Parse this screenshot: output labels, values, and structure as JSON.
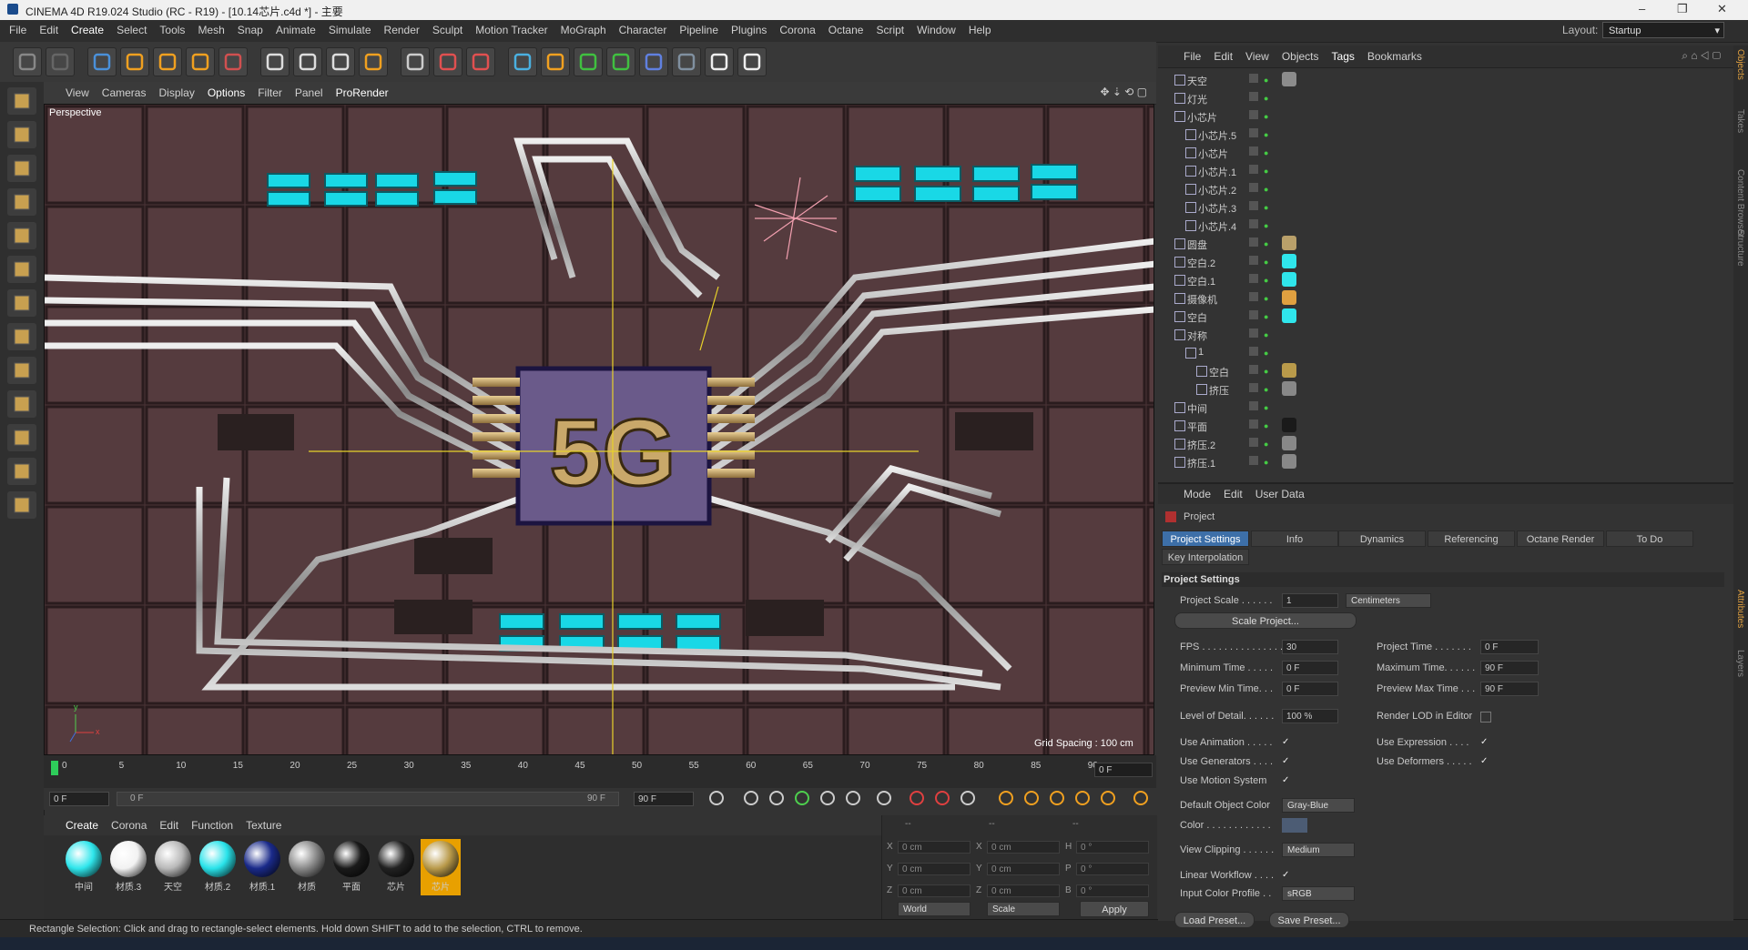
{
  "window": {
    "title": "CINEMA 4D R19.024 Studio (RC - R19) - [10.14芯片.c4d *] - 主要",
    "layout_label": "Layout:",
    "layout_value": "Startup",
    "minimize": "–",
    "maximize": "❐",
    "close": "✕"
  },
  "menubar": [
    "File",
    "Edit",
    "Create",
    "Select",
    "Tools",
    "Mesh",
    "Snap",
    "Animate",
    "Simulate",
    "Render",
    "Sculpt",
    "Motion Tracker",
    "MoGraph",
    "Character",
    "Pipeline",
    "Plugins",
    "Corona",
    "Octane",
    "Script",
    "Window",
    "Help"
  ],
  "toolbar_icons": [
    "undo-icon",
    "redo-icon",
    "live-selection-icon",
    "move-icon",
    "scale-icon",
    "rotate-icon",
    "recent-tools-icon",
    "x-axis-icon",
    "y-axis-icon",
    "z-axis-icon",
    "coordinate-system-icon",
    "render-view-icon",
    "render-picture-viewer-icon",
    "render-settings-icon",
    "cube-icon",
    "pen-icon",
    "subdivision-icon",
    "cloner-icon",
    "deformer-icon",
    "floor-icon",
    "camera-icon",
    "light-icon"
  ],
  "viewport": {
    "menu": [
      "View",
      "Cameras",
      "Display",
      "Options",
      "Filter",
      "Panel",
      "ProRender"
    ],
    "label": "Perspective",
    "grid_spacing": "Grid Spacing : 100 cm",
    "chip_text": "5G"
  },
  "timeline": {
    "ticks": [
      "0",
      "5",
      "10",
      "15",
      "20",
      "25",
      "30",
      "35",
      "40",
      "45",
      "50",
      "55",
      "60",
      "65",
      "70",
      "75",
      "80",
      "85",
      "90"
    ],
    "current_frame": "0 F",
    "start_field": "0 F",
    "range_start": "0 F",
    "range_end": "90 F",
    "end_field": "90 F"
  },
  "materials": {
    "menu": [
      "Create",
      "Corona",
      "Edit",
      "Function",
      "Texture"
    ],
    "items": [
      {
        "name": "中间",
        "color": "#2fe6ec"
      },
      {
        "name": "材质.3",
        "color": "#f2f2f2"
      },
      {
        "name": "天空",
        "color": "#b9b9b9"
      },
      {
        "name": "材质.2",
        "color": "#29e3ea"
      },
      {
        "name": "材质.1",
        "color": "#1a2a8a"
      },
      {
        "name": "材质",
        "color": "#8a8a8a"
      },
      {
        "name": "平面",
        "color": "#1a1a1a"
      },
      {
        "name": "芯片",
        "color": "#222222"
      },
      {
        "name": "芯片",
        "color": "#b99a4a"
      }
    ]
  },
  "coords": {
    "headers": [
      "--",
      "--",
      "--"
    ],
    "rows": [
      {
        "a": "X",
        "v1": "0 cm",
        "b": "X",
        "v2": "0 cm",
        "c": "H",
        "v3": "0 °"
      },
      {
        "a": "Y",
        "v1": "0 cm",
        "b": "Y",
        "v2": "0 cm",
        "c": "P",
        "v3": "0 °"
      },
      {
        "a": "Z",
        "v1": "0 cm",
        "b": "Z",
        "v2": "0 cm",
        "c": "B",
        "v3": "0 °"
      }
    ],
    "world": "World",
    "scale": "Scale",
    "apply": "Apply"
  },
  "status": "Rectangle Selection: Click and drag to rectangle-select elements. Hold down SHIFT to add to the selection, CTRL to remove.",
  "objects": {
    "menu": [
      "File",
      "Edit",
      "View",
      "Objects",
      "Tags",
      "Bookmarks"
    ],
    "rows": [
      {
        "name": "天空",
        "indent": 0,
        "tag": "#8c8c8c"
      },
      {
        "name": "灯光",
        "indent": 0,
        "tag": ""
      },
      {
        "name": "小芯片",
        "indent": 0,
        "tag": ""
      },
      {
        "name": "小芯片.5",
        "indent": 1,
        "tag": ""
      },
      {
        "name": "小芯片",
        "indent": 1,
        "tag": ""
      },
      {
        "name": "小芯片.1",
        "indent": 1,
        "tag": ""
      },
      {
        "name": "小芯片.2",
        "indent": 1,
        "tag": ""
      },
      {
        "name": "小芯片.3",
        "indent": 1,
        "tag": ""
      },
      {
        "name": "小芯片.4",
        "indent": 1,
        "tag": ""
      },
      {
        "name": "圆盘",
        "indent": 0,
        "tag": "#b9a06a"
      },
      {
        "name": "空白.2",
        "indent": 0,
        "tag": "#2fe6ec"
      },
      {
        "name": "空白.1",
        "indent": 0,
        "tag": "#2fe6ec"
      },
      {
        "name": "摄像机",
        "indent": 0,
        "tag": "#e0a040"
      },
      {
        "name": "空白",
        "indent": 0,
        "tag": "#2fe6ec"
      },
      {
        "name": "对称",
        "indent": 0,
        "tag": ""
      },
      {
        "name": "1",
        "indent": 1,
        "tag": ""
      },
      {
        "name": "空白",
        "indent": 2,
        "tag": "#b99a4a"
      },
      {
        "name": "挤压",
        "indent": 2,
        "tag": "#888888"
      },
      {
        "name": "中间",
        "indent": 0,
        "tag": ""
      },
      {
        "name": "平面",
        "indent": 0,
        "tag": "#1a1a1a"
      },
      {
        "name": "挤压.2",
        "indent": 0,
        "tag": "#888888"
      },
      {
        "name": "挤压.1",
        "indent": 0,
        "tag": "#888888"
      }
    ]
  },
  "attributes": {
    "menu": [
      "Mode",
      "Edit",
      "User Data"
    ],
    "title": "Project",
    "tabs": [
      "Project Settings",
      "Info",
      "Dynamics",
      "Referencing",
      "Octane Render",
      "To Do"
    ],
    "tab2": "Key Interpolation",
    "section": "Project Settings",
    "project_scale_label": "Project Scale . . . . . .",
    "project_scale": "1",
    "units": "Centimeters",
    "scale_project": "Scale Project...",
    "fps_label": "FPS . . . . . . . . . . . . . . .",
    "fps": "30",
    "project_time_label": "Project Time . . . . . . .",
    "project_time": "0 F",
    "min_time_label": "Minimum Time . . . . .",
    "min_time": "0 F",
    "max_time_label": "Maximum Time. . . . . .",
    "max_time": "90 F",
    "prev_min_label": "Preview Min Time. . .",
    "prev_min": "0 F",
    "prev_max_label": "Preview Max Time . . .",
    "prev_max": "90 F",
    "lod_label": "Level of Detail. . . . . .",
    "lod": "100 %",
    "render_lod_label": "Render LOD in Editor",
    "use_anim_label": "Use Animation . . . . .",
    "use_expr_label": "Use Expression . . . .",
    "use_gen_label": "Use Generators . . . .",
    "use_def_label": "Use Deformers . . . . .",
    "use_motion_label": "Use Motion System",
    "default_color_label": "Default Object Color",
    "default_color": "Gray-Blue",
    "color_label": "Color . . . . . . . . . . . .",
    "view_clip_label": "View Clipping . . . . . .",
    "view_clip": "Medium",
    "linear_label": "Linear Workflow . . . .",
    "input_profile_label": "Input Color Profile . .",
    "input_profile": "sRGB",
    "load_preset": "Load Preset...",
    "save_preset": "Save Preset...",
    "check": "✓"
  },
  "side_tabs": [
    "Objects",
    "Takes",
    "Content Browser",
    "Structure",
    "Attributes",
    "Layers"
  ]
}
